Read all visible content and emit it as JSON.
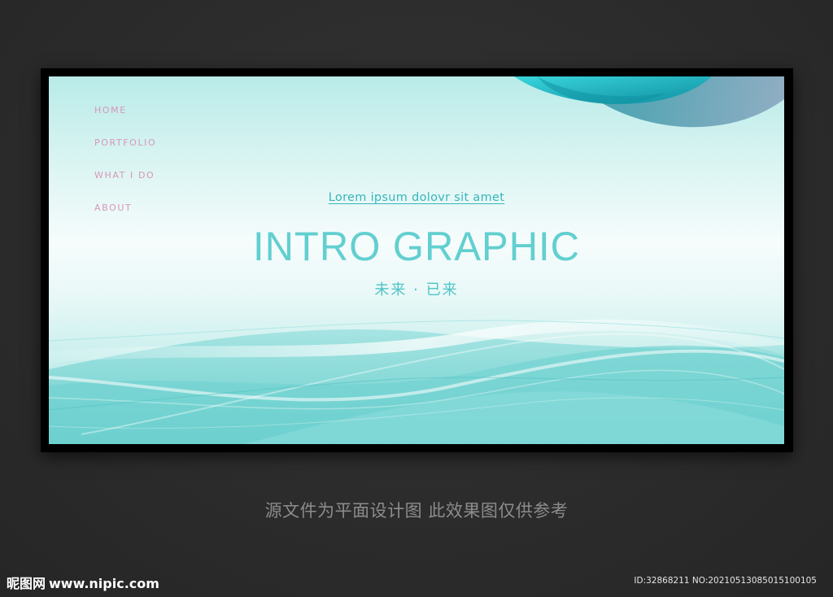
{
  "nav": {
    "items": [
      {
        "label": "HOME"
      },
      {
        "label": "PORTFOLIO"
      },
      {
        "label": "WHAT I DO"
      },
      {
        "label": "ABOUT"
      }
    ]
  },
  "hero": {
    "tagline": "Lorem ipsum dolovr sit amet",
    "headline": "INTRO GRAPHIC",
    "subline": "未来 · 已来"
  },
  "caption": "源文件为平面设计图 此效果图仅供参考",
  "watermark": {
    "logo": "昵图网",
    "url": "www.nipic.com",
    "image_id": "ID:32868211 NO:20210513085015100105"
  },
  "colors": {
    "nav_text": "#d996b8",
    "accent_teal": "#35b6bb",
    "headline": "#62cfd0",
    "background_dark": "#2d2d2d"
  }
}
